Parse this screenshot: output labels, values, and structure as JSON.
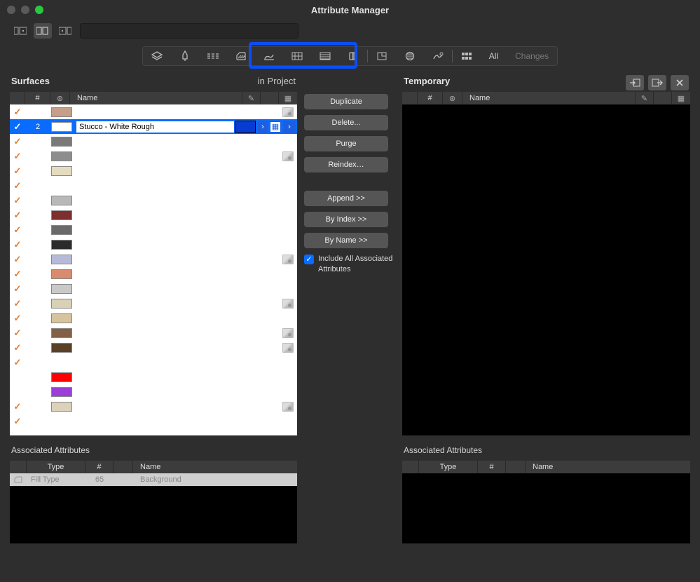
{
  "window_title": "Attribute Manager",
  "toolbar": {
    "text_all": "All",
    "text_changes": "Changes"
  },
  "left": {
    "title": "Surfaces",
    "subtitle": "in Project",
    "header": {
      "num": "#",
      "name": "Name"
    },
    "rows": [
      {
        "check": true,
        "swatch": "#c59f89",
        "thumb": true
      },
      {
        "check": true,
        "num": "2",
        "swatch_sel": "#ffffff",
        "name": "Stucco - White Rough",
        "selected": true
      },
      {
        "check": true,
        "swatch": "#7a7a7a",
        "thumb": false
      },
      {
        "check": true,
        "swatch": "#8d8d8d",
        "thumb": true
      },
      {
        "check": true,
        "swatch": "#e5dcc0",
        "thumb": false
      },
      {
        "check": true,
        "swatch": "",
        "thumb": false
      },
      {
        "check": true,
        "swatch": "#b8b8b8",
        "thumb": false
      },
      {
        "check": true,
        "swatch": "#7e2e2e",
        "thumb": false
      },
      {
        "check": true,
        "swatch": "#6a6a6a",
        "thumb": false
      },
      {
        "check": true,
        "swatch": "#2b2b2b",
        "thumb": false
      },
      {
        "check": true,
        "swatch": "#b7b9d8",
        "thumb": true
      },
      {
        "check": true,
        "swatch": "#d88b6e",
        "thumb": false
      },
      {
        "check": true,
        "swatch": "#c9c9c9",
        "thumb": false
      },
      {
        "check": true,
        "swatch": "#d9d1b5",
        "thumb": true
      },
      {
        "check": true,
        "swatch": "#d6c49f",
        "thumb": false
      },
      {
        "check": true,
        "swatch": "#836045",
        "thumb": true
      },
      {
        "check": true,
        "swatch": "#5a4027",
        "thumb": true
      },
      {
        "check": true,
        "swatch": "",
        "thumb": false
      },
      {
        "check": false,
        "swatch": "#ff0000",
        "thumb": false
      },
      {
        "check": false,
        "swatch": "#9b3fd6",
        "thumb": false
      },
      {
        "check": true,
        "swatch": "#dcd1bb",
        "thumb": true
      },
      {
        "check": true,
        "swatch": "",
        "thumb": false
      }
    ]
  },
  "mid": {
    "duplicate": "Duplicate",
    "delete": "Delete...",
    "purge": "Purge",
    "reindex": "Reindex…",
    "append": "Append >>",
    "by_index": "By Index >>",
    "by_name": "By Name >>",
    "include_label": "Include All Associated Attributes"
  },
  "right": {
    "title": "Temporary",
    "header": {
      "num": "#",
      "name": "Name"
    }
  },
  "assoc": {
    "title": "Associated Attributes",
    "header": {
      "type": "Type",
      "num": "#",
      "name": "Name"
    },
    "row": {
      "type": "Fill Type",
      "num": "65",
      "name": "Background"
    }
  }
}
